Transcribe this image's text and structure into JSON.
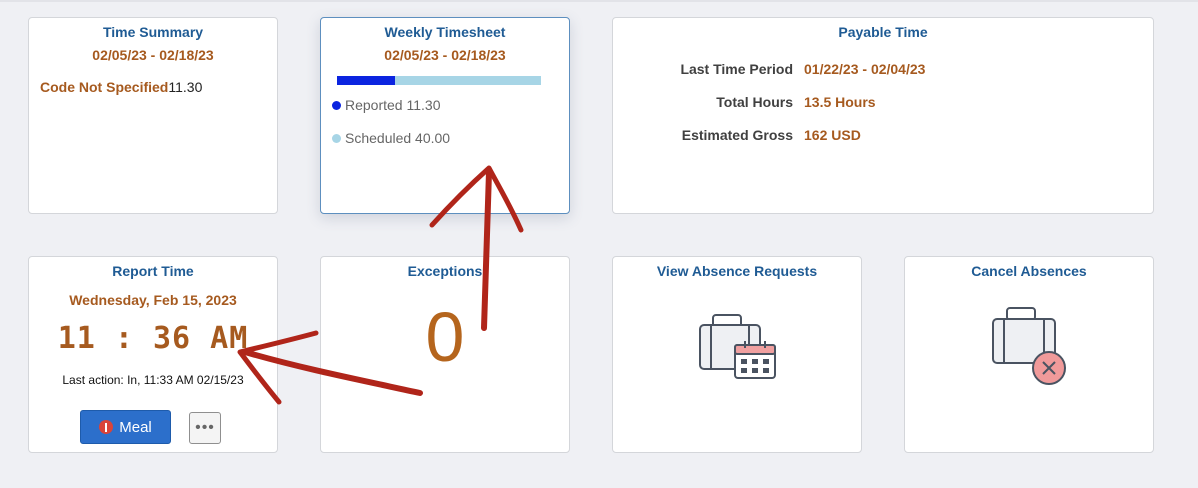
{
  "tiles": {
    "time_summary": {
      "title": "Time Summary",
      "period": "02/05/23 - 02/18/23",
      "code_label": "Code Not Specified",
      "code_value": "11.30"
    },
    "weekly_timesheet": {
      "title": "Weekly Timesheet",
      "period": "02/05/23 - 02/18/23",
      "reported_fraction": 0.2825,
      "legend": [
        {
          "label": "Reported 11.30",
          "color": "#0b24e0"
        },
        {
          "label": "Scheduled 40.00",
          "color": "#a7d5e6"
        }
      ]
    },
    "payable_time": {
      "title": "Payable Time",
      "rows": [
        {
          "label": "Last Time Period",
          "value": "01/22/23 - 02/04/23"
        },
        {
          "label": "Total Hours",
          "value": "13.5 Hours"
        },
        {
          "label": "Estimated Gross",
          "value": "162 USD"
        }
      ]
    },
    "report_time": {
      "title": "Report Time",
      "date": "Wednesday, Feb 15, 2023",
      "clock": "11 : 36 AM",
      "last_action": "Last action: In, 11:33 AM 02/15/23",
      "meal_label": "Meal",
      "more_label": "•••",
      "meal_icon": "meal-icon"
    },
    "exceptions": {
      "title": "Exceptions",
      "count": "0"
    },
    "view_absence": {
      "title": "View Absence Requests",
      "icon": "suitcase-calendar-icon"
    },
    "cancel_absences": {
      "title": "Cancel Absences",
      "icon": "suitcase-cancel-icon"
    }
  },
  "colors": {
    "title_blue": "#1f5b94",
    "accent_orange": "#a65a1f",
    "annotation_red": "#b0251a"
  }
}
